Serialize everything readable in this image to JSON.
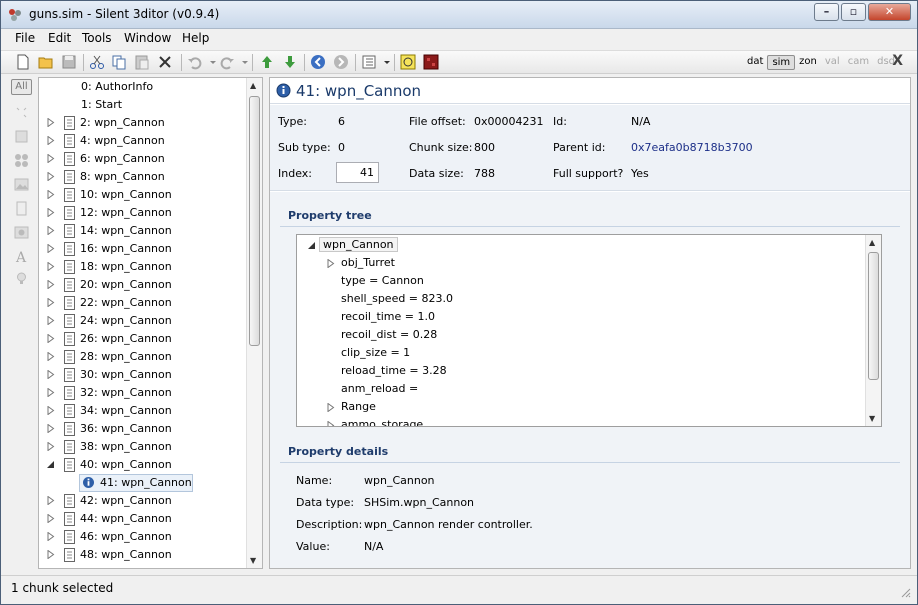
{
  "window": {
    "title": "guns.sim - Silent 3ditor (v0.9.4)"
  },
  "menu": [
    "File",
    "Edit",
    "Tools",
    "Window",
    "Help"
  ],
  "view_modes": [
    {
      "label": "dat",
      "state": "normal"
    },
    {
      "label": "sim",
      "state": "active"
    },
    {
      "label": "zon",
      "state": "normal"
    },
    {
      "label": "val",
      "state": "dim"
    },
    {
      "label": "cam",
      "state": "dim"
    },
    {
      "label": "dsd",
      "state": "dim"
    }
  ],
  "toolbar_close": "X",
  "filter_strip": {
    "all_label": "All"
  },
  "tree": {
    "items": [
      {
        "label": "0: AuthorInfo",
        "kind": "plain"
      },
      {
        "label": "1: Start",
        "kind": "plain"
      },
      {
        "label": "2: wpn_Cannon",
        "kind": "collapsed"
      },
      {
        "label": "4: wpn_Cannon",
        "kind": "collapsed"
      },
      {
        "label": "6: wpn_Cannon",
        "kind": "collapsed"
      },
      {
        "label": "8: wpn_Cannon",
        "kind": "collapsed"
      },
      {
        "label": "10: wpn_Cannon",
        "kind": "collapsed"
      },
      {
        "label": "12: wpn_Cannon",
        "kind": "collapsed"
      },
      {
        "label": "14: wpn_Cannon",
        "kind": "collapsed"
      },
      {
        "label": "16: wpn_Cannon",
        "kind": "collapsed"
      },
      {
        "label": "18: wpn_Cannon",
        "kind": "collapsed"
      },
      {
        "label": "20: wpn_Cannon",
        "kind": "collapsed"
      },
      {
        "label": "22: wpn_Cannon",
        "kind": "collapsed"
      },
      {
        "label": "24: wpn_Cannon",
        "kind": "collapsed"
      },
      {
        "label": "26: wpn_Cannon",
        "kind": "collapsed"
      },
      {
        "label": "28: wpn_Cannon",
        "kind": "collapsed"
      },
      {
        "label": "30: wpn_Cannon",
        "kind": "collapsed"
      },
      {
        "label": "32: wpn_Cannon",
        "kind": "collapsed"
      },
      {
        "label": "34: wpn_Cannon",
        "kind": "collapsed"
      },
      {
        "label": "36: wpn_Cannon",
        "kind": "collapsed"
      },
      {
        "label": "38: wpn_Cannon",
        "kind": "collapsed"
      },
      {
        "label": "40: wpn_Cannon",
        "kind": "expanded"
      },
      {
        "label": "41: wpn_Cannon",
        "kind": "selected"
      },
      {
        "label": "42: wpn_Cannon",
        "kind": "collapsed"
      },
      {
        "label": "44: wpn_Cannon",
        "kind": "collapsed"
      },
      {
        "label": "46: wpn_Cannon",
        "kind": "collapsed"
      },
      {
        "label": "48: wpn_Cannon",
        "kind": "collapsed"
      }
    ]
  },
  "detail": {
    "header": "41: wpn_Cannon",
    "type_label": "Type:",
    "type_value": "6",
    "subtype_label": "Sub type:",
    "subtype_value": "0",
    "index_label": "Index:",
    "index_value": "41",
    "fileoffset_label": "File offset:",
    "fileoffset_value": "0x00004231",
    "chunksize_label": "Chunk size:",
    "chunksize_value": "800",
    "datasize_label": "Data size:",
    "datasize_value": "788",
    "id_label": "Id:",
    "id_value": "N/A",
    "parentid_label": "Parent id:",
    "parentid_value": "0x7eafa0b8718b3700",
    "fullsupport_label": "Full support?",
    "fullsupport_value": "Yes"
  },
  "property_tree": {
    "title": "Property tree",
    "root": "wpn_Cannon",
    "items": [
      {
        "label": "obj_Turret",
        "expandable": true
      },
      {
        "label": "type = Cannon",
        "expandable": false
      },
      {
        "label": "shell_speed = 823.0",
        "expandable": false
      },
      {
        "label": "recoil_time = 1.0",
        "expandable": false
      },
      {
        "label": "recoil_dist = 0.28",
        "expandable": false
      },
      {
        "label": "clip_size = 1",
        "expandable": false
      },
      {
        "label": "reload_time = 3.28",
        "expandable": false
      },
      {
        "label": "anm_reload =",
        "expandable": false
      },
      {
        "label": "Range",
        "expandable": true
      },
      {
        "label": "ammo_storage",
        "expandable": true
      }
    ]
  },
  "property_details": {
    "title": "Property details",
    "name_label": "Name:",
    "name_value": "wpn_Cannon",
    "datatype_label": "Data type:",
    "datatype_value": "SHSim.wpn_Cannon",
    "description_label": "Description:",
    "description_value": "wpn_Cannon render controller.",
    "value_label": "Value:",
    "value_value": "N/A"
  },
  "status": {
    "text": "1 chunk selected"
  }
}
